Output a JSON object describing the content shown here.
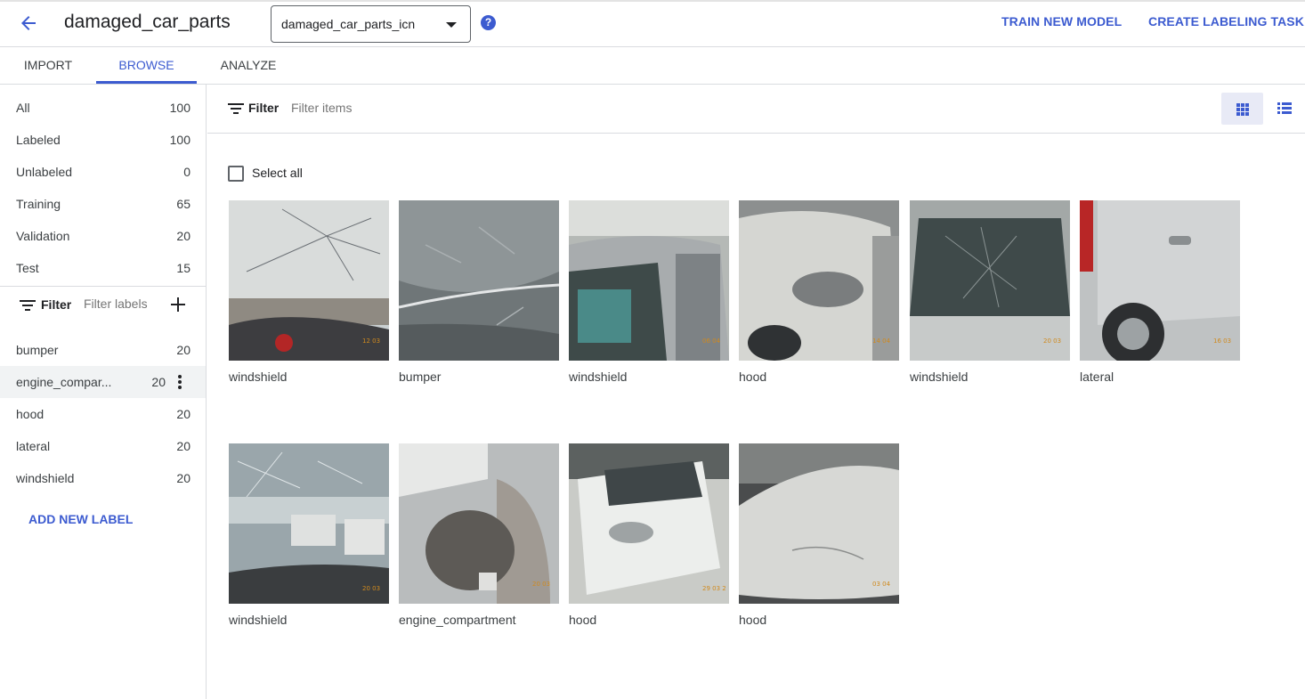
{
  "header": {
    "title": "damaged_car_parts",
    "model_select": "damaged_car_parts_icn",
    "help": "?",
    "train_button": "TRAIN NEW MODEL",
    "labeling_button": "CREATE LABELING TASK"
  },
  "tabs": [
    {
      "label": "IMPORT",
      "active": false
    },
    {
      "label": "BROWSE",
      "active": true
    },
    {
      "label": "ANALYZE",
      "active": false
    }
  ],
  "sidebar": {
    "splits": [
      {
        "label": "All",
        "count": "100"
      },
      {
        "label": "Labeled",
        "count": "100"
      },
      {
        "label": "Unlabeled",
        "count": "0"
      },
      {
        "label": "Training",
        "count": "65"
      },
      {
        "label": "Validation",
        "count": "20"
      },
      {
        "label": "Test",
        "count": "15"
      }
    ],
    "filter_label": "Filter",
    "filter_placeholder": "Filter labels",
    "labels": [
      {
        "label": "bumper",
        "count": "20"
      },
      {
        "label": "engine_compar...",
        "count": "20"
      },
      {
        "label": "hood",
        "count": "20"
      },
      {
        "label": "lateral",
        "count": "20"
      },
      {
        "label": "windshield",
        "count": "20"
      }
    ],
    "add_label": "ADD NEW LABEL"
  },
  "toolbar": {
    "filter_label": "Filter",
    "filter_placeholder": "Filter items",
    "select_all": "Select all"
  },
  "images": [
    {
      "label": "windshield",
      "date": "12 03"
    },
    {
      "label": "bumper",
      "date": ""
    },
    {
      "label": "windshield",
      "date": "06 04"
    },
    {
      "label": "hood",
      "date": "14 04"
    },
    {
      "label": "windshield",
      "date": "20 03"
    },
    {
      "label": "lateral",
      "date": "16 03"
    },
    {
      "label": "windshield",
      "date": "20 03"
    },
    {
      "label": "engine_compartment",
      "date": "20 03"
    },
    {
      "label": "hood",
      "date": "29 03 2"
    },
    {
      "label": "hood",
      "date": "03 04"
    }
  ],
  "colors": {
    "accent": "#3c5bd0",
    "text": "#202124",
    "muted_text": "#3c4043",
    "divider": "#dadce0",
    "highlight_row": "#f1f3f4"
  }
}
